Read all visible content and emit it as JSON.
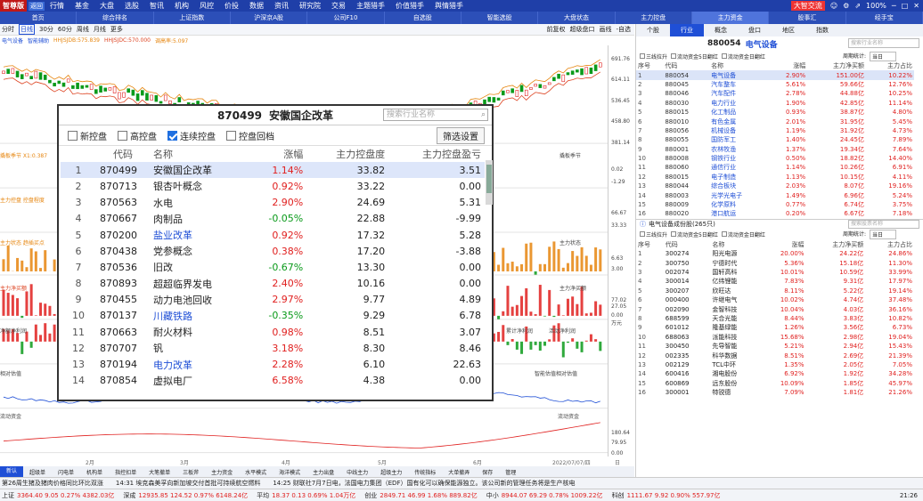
{
  "titlebar": {
    "app_name": "智尊版",
    "version": "返回",
    "menus": [
      "行情",
      "基金",
      "大盘",
      "选股",
      "智讯",
      "机构",
      "风控",
      "价投",
      "数据",
      "资讯",
      "研究院",
      "交易",
      "主题猎手",
      "价值猎手",
      "舆情猎手"
    ],
    "trade_btn": "大智交流",
    "zoom": "100%"
  },
  "navbar": {
    "items": [
      "首页",
      "综合排名",
      "上证指数",
      "沪深京A股",
      "公司F10",
      "自选股",
      "智能选股",
      "大盘状态",
      "主力控盘",
      "主力资金",
      "股事汇",
      "经手宝"
    ],
    "active_index": 9
  },
  "toolbar1": {
    "left": [
      "分时",
      "日线",
      "30分",
      "60分",
      "周线",
      "月线",
      "更多"
    ],
    "active_index": 1,
    "right": [
      "前复权",
      "超级盘口",
      "画线",
      "-自选"
    ]
  },
  "toolbar2": {
    "labels": [
      "电气设备",
      "智能辅助",
      "HHJSJDB:575.839",
      "HHJSJDC:570.000",
      "调高率:5.097"
    ]
  },
  "chart_labels": {
    "yaxis": [
      "691.76",
      "614.11",
      "536.45",
      "458.80",
      "381.14",
      "0.02",
      "-1.29",
      "66.67",
      "33.33",
      "6.63",
      "3.00",
      "77.02",
      "27.05",
      "0.00",
      "万元",
      "180.64",
      "79.95",
      "0.00"
    ],
    "pane2": "撬板季节  X1:0.387",
    "pane3": "主力控盘  控盘程度",
    "pane4": "主力状态  趋插买点",
    "pane5": "主力净买额",
    "pane6": "净额净利润",
    "pane7": "相对估值",
    "pane8": "流动资金",
    "right1": "撬板季节",
    "right2": "主力状态",
    "right3": "主力净买额",
    "right4": "累计净利润",
    "right5": "活动净利润",
    "right6": "智能估值相对估值",
    "right7": "流动资金",
    "dates": [
      "2月",
      "3月",
      "4月",
      "5月",
      "6月",
      "2022/07/07/四"
    ],
    "week_label": "日线"
  },
  "bottom_tabs": {
    "items": [
      "新认",
      "超级单",
      "闪电单",
      "机构单",
      "指控扣单",
      "大笔撤单",
      "三板斧",
      "主力资金",
      "水平模式",
      "海洋模式",
      "主力出盘",
      "中线主力",
      "超级主力",
      "传统指标",
      "大单撤弄",
      "保存",
      "管理"
    ],
    "active_index": 0
  },
  "news": {
    "items": [
      "第26周生猪及猪肉价格同比环比双涨",
      "14:31 埃克森美孚向新加坡交付首批可持续航空燃料",
      "14:25 财联社7月7日电，法国电力集团（EDF）国有化可以确保能源独立。该公司新的管理任务将是生产核电"
    ]
  },
  "quotebar": {
    "items": [
      {
        "name": "上证",
        "text": "3364.40  9.05  0.27%  4382.03亿",
        "color": "red"
      },
      {
        "name": "深成",
        "text": "12935.85  124.52  0.97%  6148.24亿",
        "color": "red"
      },
      {
        "name": "平均",
        "text": "18.37  0.13  0.69%  1.04万亿",
        "color": "red"
      },
      {
        "name": "创业",
        "text": "2849.71  46.99  1.68%  889.82亿",
        "color": "red"
      },
      {
        "name": "中小",
        "text": "8944.07  69.29  0.78%  1009.22亿",
        "color": "red"
      },
      {
        "name": "科创",
        "text": "1111.67  9.92  0.90%  557.97亿",
        "color": "red"
      }
    ],
    "clock": "21:26"
  },
  "popup": {
    "code": "870499",
    "name": "安徽国企改革",
    "search_placeholder": "搜索行业名称",
    "filters": [
      {
        "label": "新控盘",
        "checked": false
      },
      {
        "label": "高控盘",
        "checked": false
      },
      {
        "label": "连续控盘",
        "checked": true
      },
      {
        "label": "控盘回档",
        "checked": false
      }
    ],
    "settings_btn": "筛选设置",
    "columns": [
      "",
      "代码",
      "名称",
      "涨幅",
      "主力控盘度",
      "主力控盘盈亏"
    ],
    "rows": [
      [
        "1",
        "870499",
        "安徽国企改革",
        "1.14%",
        "33.82",
        "3.51"
      ],
      [
        "2",
        "870713",
        "银杏叶概念",
        "0.92%",
        "33.22",
        "0.00"
      ],
      [
        "3",
        "870563",
        "水电",
        "2.90%",
        "24.69",
        "5.31"
      ],
      [
        "4",
        "870667",
        "肉制品",
        "-0.05%",
        "22.88",
        "-9.99"
      ],
      [
        "5",
        "870200",
        "盐业改革",
        "0.92%",
        "17.32",
        "5.28"
      ],
      [
        "6",
        "870438",
        "党参概念",
        "0.38%",
        "17.20",
        "-3.88"
      ],
      [
        "7",
        "870536",
        "旧改",
        "-0.67%",
        "13.30",
        "0.00"
      ],
      [
        "8",
        "870893",
        "超超临界发电",
        "2.40%",
        "10.16",
        "0.00"
      ],
      [
        "9",
        "870455",
        "动力电池回收",
        "2.97%",
        "9.77",
        "4.89"
      ],
      [
        "10",
        "870137",
        "川藏铁路",
        "-0.35%",
        "9.29",
        "6.78"
      ],
      [
        "11",
        "870663",
        "耐火材料",
        "0.98%",
        "8.51",
        "3.07"
      ],
      [
        "12",
        "870707",
        "钒",
        "3.18%",
        "8.30",
        "8.46"
      ],
      [
        "13",
        "870194",
        "电力改革",
        "2.28%",
        "6.10",
        "22.63"
      ],
      [
        "14",
        "870854",
        "虚拟电厂",
        "6.58%",
        "4.38",
        "0.00"
      ]
    ],
    "blue_names": [
      "盐业改革",
      "川藏铁路",
      "电力改革"
    ]
  },
  "rpanel": {
    "tabs": [
      "个股",
      "行业",
      "概念",
      "盘口",
      "地区",
      "指数"
    ],
    "active_tab": 1,
    "code": "880054",
    "name": "电气设备",
    "search_placeholder": "搜索行业名称",
    "opts": [
      "三线拉升",
      "流动资金5日翻红",
      "流动资金日翻红"
    ],
    "period_label": "周期统计:",
    "period_value": "当日",
    "columns": [
      "序号",
      "代码",
      "名称",
      "涨幅",
      "主力净买额",
      "主力占比"
    ],
    "rows": [
      [
        "1",
        "880054",
        "电气设备",
        "2.90%",
        "151.00亿",
        "10.22%"
      ],
      [
        "2",
        "880045",
        "汽车整车",
        "5.61%",
        "59.66亿",
        "12.76%"
      ],
      [
        "3",
        "880046",
        "汽车配件",
        "2.78%",
        "44.88亿",
        "10.25%"
      ],
      [
        "4",
        "880030",
        "电力行业",
        "1.90%",
        "42.85亿",
        "11.14%"
      ],
      [
        "5",
        "880015",
        "化工制品",
        "0.93%",
        "38.87亿",
        "4.80%"
      ],
      [
        "6",
        "880010",
        "有色金属",
        "2.01%",
        "31.95亿",
        "5.45%"
      ],
      [
        "7",
        "880056",
        "机械设备",
        "1.19%",
        "31.92亿",
        "4.73%"
      ],
      [
        "8",
        "880055",
        "国防军工",
        "1.40%",
        "24.45亿",
        "7.89%"
      ],
      [
        "9",
        "880001",
        "农林牧渔",
        "1.37%",
        "19.34亿",
        "7.64%"
      ],
      [
        "10",
        "880008",
        "钢铁行业",
        "0.50%",
        "18.82亿",
        "14.40%"
      ],
      [
        "11",
        "880060",
        "通信行业",
        "1.14%",
        "10.26亿",
        "6.91%"
      ],
      [
        "12",
        "880015",
        "电子制造",
        "1.13%",
        "10.15亿",
        "4.11%"
      ],
      [
        "13",
        "880044",
        "综合板块",
        "2.03%",
        "8.07亿",
        "19.16%"
      ],
      [
        "14",
        "880003",
        "光学光电子",
        "1.49%",
        "6.96亿",
        "5.24%"
      ],
      [
        "15",
        "880009",
        "化学原料",
        "0.77%",
        "6.74亿",
        "3.75%"
      ],
      [
        "16",
        "880020",
        "港口航运",
        "0.20%",
        "6.67亿",
        "7.18%"
      ]
    ],
    "sub_title": "电气设备成份股(265只)",
    "sub_search_placeholder": "搜索股票名称",
    "sub_rows": [
      [
        "1",
        "300274",
        "阳光电源",
        "20.00%",
        "24.22亿",
        "24.86%"
      ],
      [
        "2",
        "300750",
        "宁德时代",
        "5.36%",
        "15.18亿",
        "11.30%"
      ],
      [
        "3",
        "002074",
        "国轩高科",
        "10.01%",
        "10.59亿",
        "33.99%"
      ],
      [
        "4",
        "300014",
        "亿纬锂能",
        "7.83%",
        "9.31亿",
        "17.97%"
      ],
      [
        "5",
        "300207",
        "欣旺达",
        "8.11%",
        "5.22亿",
        "19.14%"
      ],
      [
        "6",
        "000400",
        "许继电气",
        "10.02%",
        "4.74亿",
        "37.48%"
      ],
      [
        "7",
        "002090",
        "金智科技",
        "10.04%",
        "4.03亿",
        "36.16%"
      ],
      [
        "8",
        "688599",
        "天合光能",
        "8.44%",
        "3.83亿",
        "10.82%"
      ],
      [
        "9",
        "601012",
        "隆基绿能",
        "1.26%",
        "3.56亿",
        "6.73%"
      ],
      [
        "10",
        "688063",
        "派能科技",
        "15.68%",
        "2.98亿",
        "19.04%"
      ],
      [
        "11",
        "300450",
        "先导智能",
        "5.21%",
        "2.94亿",
        "15.43%"
      ],
      [
        "12",
        "002335",
        "科华数据",
        "8.51%",
        "2.69亿",
        "21.39%"
      ],
      [
        "13",
        "002129",
        "TCL中环",
        "1.35%",
        "2.05亿",
        "7.05%"
      ],
      [
        "14",
        "600416",
        "湘电股份",
        "6.92%",
        "1.92亿",
        "34.28%"
      ],
      [
        "15",
        "600869",
        "远东股份",
        "10.09%",
        "1.85亿",
        "45.97%"
      ],
      [
        "16",
        "300001",
        "特锐德",
        "7.09%",
        "1.81亿",
        "21.26%"
      ]
    ]
  }
}
